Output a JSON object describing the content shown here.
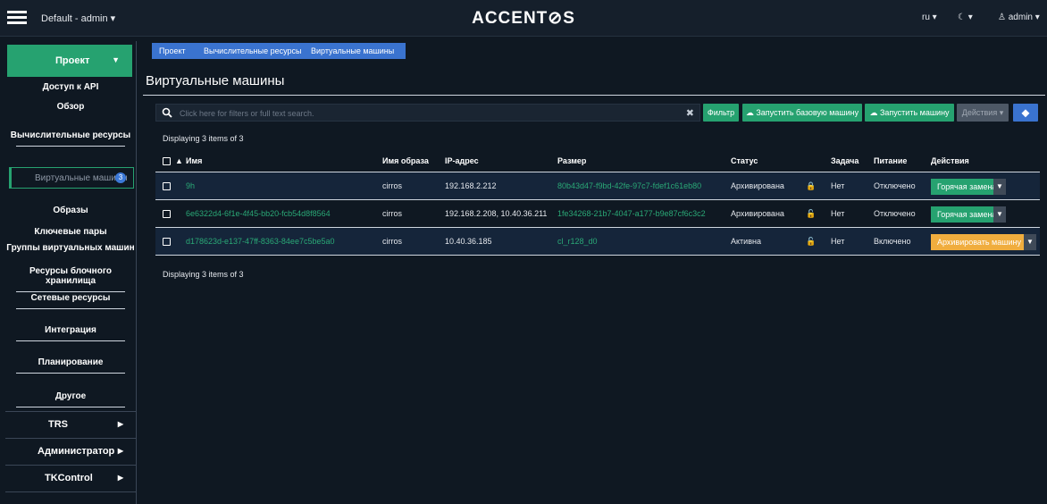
{
  "header": {
    "project_menu": "Default - admin ▾",
    "logo": "ACCENT⊘S",
    "lang": "ru ▾",
    "theme": "☾ ▾",
    "user": "admin ▾"
  },
  "sidebar": {
    "project": "Проект",
    "items": [
      "Доступ к API",
      "Обзор",
      "Вычислительные ресурсы",
      "Виртуальные машины",
      "Образы",
      "Ключевые пары",
      "Группы виртуальных машин",
      "Ресурсы блочного хранилища",
      "Сетевые ресурсы",
      "Интеграция",
      "Планирование",
      "Другое"
    ],
    "active_badge": "3",
    "groups": [
      "TRS",
      "Администратор",
      "TKControl"
    ]
  },
  "breadcrumb": [
    "Проект",
    "Вычислительные ресурсы",
    "Виртуальные машины"
  ],
  "page_title": "Виртуальные машины",
  "toolbar": {
    "search_placeholder": "Click here for filters or full text search.",
    "filter": "Фильтр",
    "launch_base": "Запустить базовую машину",
    "launch": "Запустить машину",
    "actions": "Действия ▾"
  },
  "display_text": "Displaying 3 items of 3",
  "table": {
    "columns": [
      "Имя",
      "Имя образа",
      "IP-адрес",
      "Размер",
      "Статус",
      "Задача",
      "Питание",
      "Действия"
    ],
    "rows": [
      {
        "name": "9h",
        "image": "cirros",
        "ip": "192.168.2.212",
        "size": "80b43d47-f9bd-42fe-97c7-fdef1c61eb80",
        "status": "Архивирована",
        "task": "Нет",
        "power": "Отключено",
        "action": "Горячая замена"
      },
      {
        "name": "6e6322d4-6f1e-4f45-bb20-fcb54d8f8564",
        "image": "cirros",
        "ip": "192.168.2.208, 10.40.36.211",
        "size": "1fe34268-21b7-4047-a177-b9e87cf6c3c2",
        "status": "Архивирована",
        "task": "Нет",
        "power": "Отключено",
        "action": "Горячая замена"
      },
      {
        "name": "d178623d-e137-47ff-8363-84ee7c5be5a0",
        "image": "cirros",
        "ip": "10.40.36.185",
        "size": "cl_r128_d0",
        "status": "Активна",
        "task": "Нет",
        "power": "Включено",
        "action": "Архивировать машину"
      }
    ]
  },
  "colors": {
    "accent_green": "#26a270",
    "accent_blue": "#3a73cf",
    "accent_orange": "#f0ad3e"
  }
}
